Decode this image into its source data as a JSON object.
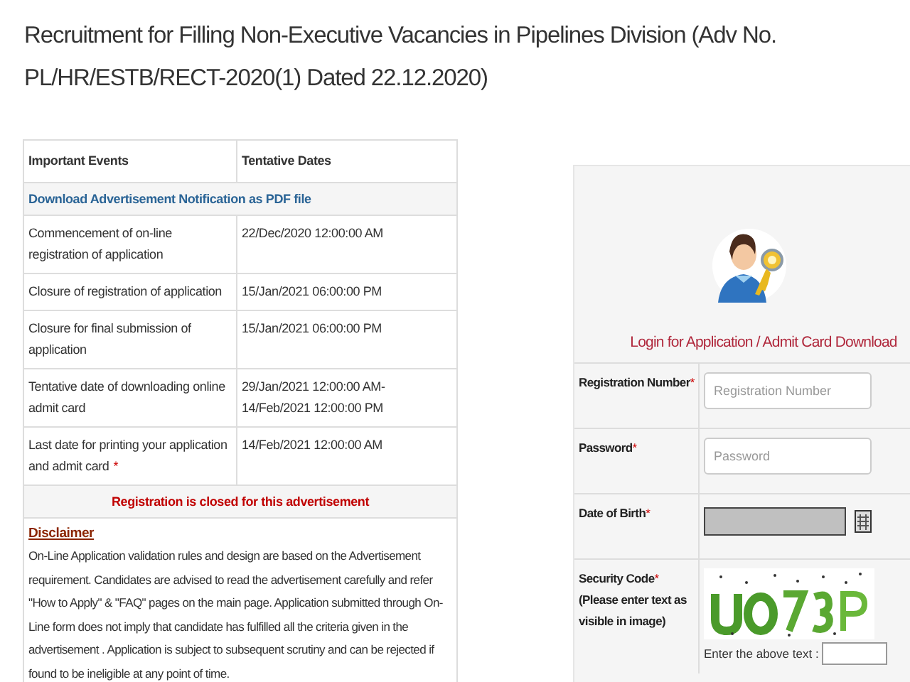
{
  "title_lines": [
    "Recruitment for Filling Non-Executive Vacancies in Pipelines Division (Adv No.",
    "PL/HR/ESTB/RECT-2020(1) Dated 22.12.2020)"
  ],
  "events_table": {
    "columns": [
      "Important Events",
      "Tentative Dates"
    ],
    "download_link": "Download Advertisement Notification as PDF file",
    "rows": [
      {
        "event": "Commencement of on-line registration of application",
        "date": "22/Dec/2020 12:00:00 AM"
      },
      {
        "event": "Closure of registration of application",
        "date": "15/Jan/2021 06:00:00 PM"
      },
      {
        "event": "Closure for final submission of application",
        "date": "15/Jan/2021 06:00:00 PM"
      },
      {
        "event": "Tentative date of downloading online admit card",
        "date": "29/Jan/2021 12:00:00 AM-14/Feb/2021 12:00:00 PM"
      },
      {
        "event": "Last date for printing your application and admit card",
        "mark": "*",
        "date": "14/Feb/2021 12:00:00 AM"
      }
    ],
    "status": "Registration is closed for this advertisement",
    "disclaimer_title": "Disclaimer",
    "disclaimer_text": "On-Line Application validation rules and design are based on the Advertisement requirement. Candidates are advised to read the advertisement carefully and refer \"How to Apply\" & \"FAQ\" pages on the main page. Application submitted through On-Line form does not imply that candidate has fulfilled all the criteria given in the advertisement . Application is subject to subsequent scrutiny and can be rejected if found to be ineligible at any point of time."
  },
  "login": {
    "heading": "Login for Application / Admit Card Download",
    "fields": [
      {
        "kind": "text",
        "label": "Registration Number",
        "mark": "*",
        "placeholder": "Registration Number"
      },
      {
        "kind": "text",
        "label": "Password",
        "mark": "*",
        "placeholder": "Password"
      },
      {
        "kind": "date",
        "label": "Date of Birth",
        "mark": "*"
      },
      {
        "kind": "captcha",
        "label": "Security Code",
        "mark": "*",
        "note": "(Please enter text as visible in image)",
        "prompt": "Enter the above text :"
      }
    ]
  }
}
